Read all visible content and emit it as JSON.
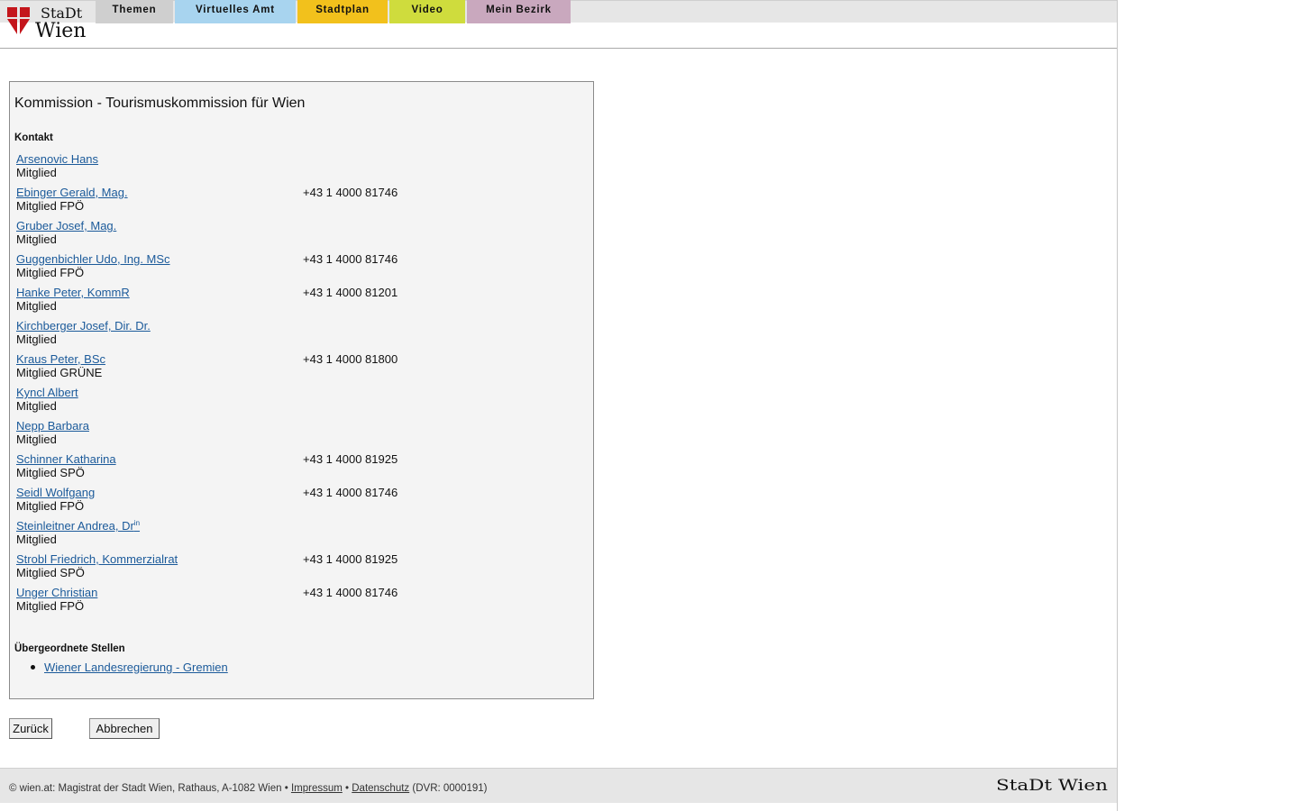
{
  "header": {
    "logo_text_line1": "StaDt",
    "logo_text_line2": "Wien",
    "nav": [
      "Themen",
      "Virtuelles Amt",
      "Stadtplan",
      "Video",
      "Mein Bezirk"
    ]
  },
  "main": {
    "title": "Kommission - Tourismuskommission für Wien",
    "contact_label": "Kontakt",
    "members": [
      {
        "name": "Arsenovic Hans",
        "suffix": "",
        "role": "Mitglied",
        "phone": ""
      },
      {
        "name": "Ebinger Gerald, Mag.",
        "suffix": "",
        "role": "Mitglied FPÖ",
        "phone": "+43 1 4000 81746"
      },
      {
        "name": "Gruber Josef, Mag.",
        "suffix": "",
        "role": "Mitglied",
        "phone": ""
      },
      {
        "name": "Guggenbichler Udo, Ing. MSc",
        "suffix": "",
        "role": "Mitglied FPÖ",
        "phone": "+43 1 4000 81746"
      },
      {
        "name": "Hanke Peter, KommR",
        "suffix": "",
        "role": "Mitglied",
        "phone": "+43 1 4000 81201"
      },
      {
        "name": "Kirchberger Josef, Dir. Dr.",
        "suffix": "",
        "role": "Mitglied",
        "phone": ""
      },
      {
        "name": "Kraus Peter, BSc",
        "suffix": "",
        "role": "Mitglied GRÜNE",
        "phone": "+43 1 4000 81800"
      },
      {
        "name": "Kyncl Albert",
        "suffix": "",
        "role": "Mitglied",
        "phone": ""
      },
      {
        "name": "Nepp Barbara",
        "suffix": "",
        "role": "Mitglied",
        "phone": ""
      },
      {
        "name": "Schinner Katharina",
        "suffix": "",
        "role": "Mitglied SPÖ",
        "phone": "+43 1 4000 81925"
      },
      {
        "name": "Seidl Wolfgang",
        "suffix": "",
        "role": "Mitglied FPÖ",
        "phone": "+43 1 4000 81746"
      },
      {
        "name": "Steinleitner Andrea, Dr",
        "suffix": "in",
        "role": "Mitglied",
        "phone": ""
      },
      {
        "name": "Strobl Friedrich, Kommerzialrat",
        "suffix": "",
        "role": "Mitglied SPÖ",
        "phone": "+43 1 4000 81925"
      },
      {
        "name": "Unger Christian",
        "suffix": "",
        "role": "Mitglied FPÖ",
        "phone": "+43 1 4000 81746"
      }
    ],
    "parent_label": "Übergeordnete Stellen",
    "parent_links": [
      "Wiener Landesregierung - Gremien"
    ]
  },
  "actions": {
    "back_label": "Zurück",
    "cancel_label": "Abbrechen"
  },
  "footer": {
    "prefix": "© wien.at: Magistrat der Stadt Wien, Rathaus, A-1082 Wien •",
    "impressum": "Impressum",
    "sep": "•",
    "datenschutz": "Datenschutz",
    "dvr": "(DVR: 0000191)",
    "logo_text": "StaDt Wien"
  },
  "colors": {
    "nav_themen": "#cfcfcf",
    "nav_amt": "#a8d4ef",
    "nav_stadtplan": "#f2c11c",
    "nav_video": "#cfdc3d",
    "nav_bezirk": "#c9a8be",
    "link": "#1b5a9a",
    "logo_red": "#c4161c"
  }
}
